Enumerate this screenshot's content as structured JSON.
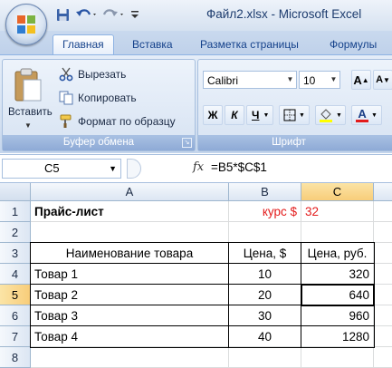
{
  "window": {
    "title": "Файл2.xlsx - Microsoft Excel"
  },
  "quick_access": {
    "icons": [
      "save-icon",
      "undo-icon",
      "redo-icon",
      "customize-icon"
    ]
  },
  "tabs": [
    {
      "label": "Главная",
      "active": true
    },
    {
      "label": "Вставка",
      "active": false
    },
    {
      "label": "Разметка страницы",
      "active": false
    },
    {
      "label": "Формулы",
      "active": false
    }
  ],
  "ribbon": {
    "clipboard": {
      "paste_label": "Вставить",
      "cut_label": "Вырезать",
      "copy_label": "Копировать",
      "format_painter_label": "Формат по образцу",
      "group_label": "Буфер обмена"
    },
    "font": {
      "font_name": "Calibri",
      "font_size": "10",
      "bold": "Ж",
      "italic": "К",
      "underline": "Ч",
      "grow": "A",
      "shrink": "A",
      "font_color_letter": "A",
      "group_label": "Шрифт",
      "highlight_color": "#ffff00",
      "font_color": "#e31b1b"
    }
  },
  "formula_bar": {
    "name_box": "C5",
    "fx": "fx",
    "formula": "=B5*$C$1"
  },
  "sheet": {
    "columns": [
      "A",
      "B",
      "C"
    ],
    "selected_column": "C",
    "rows": [
      "1",
      "2",
      "3",
      "4",
      "5",
      "6",
      "7",
      "8"
    ],
    "selected_row": "5",
    "cells": {
      "A1": "Прайс-лист",
      "B1": "курс $",
      "C1": "32",
      "A3": "Наименование товара",
      "B3": "Цена, $",
      "C3": "Цена, руб.",
      "A4": "Товар 1",
      "B4": "10",
      "C4": "320",
      "A5": "Товар 2",
      "B5": "20",
      "C5": "640",
      "A6": "Товар 3",
      "B6": "30",
      "C6": "960",
      "A7": "Товар 4",
      "B7": "40",
      "C7": "1280"
    },
    "active_cell": "C5",
    "accent_red": "#e31b1b"
  }
}
